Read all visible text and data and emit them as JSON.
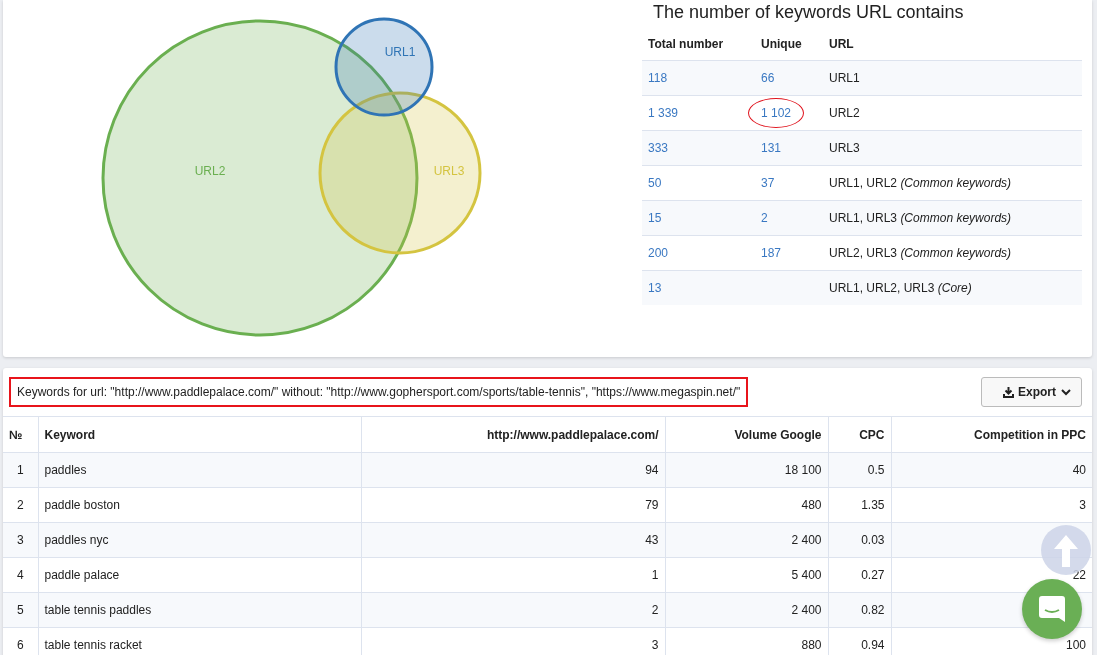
{
  "venn": {
    "circles": [
      {
        "label": "URL2",
        "color": "#6aaf50"
      },
      {
        "label": "URL3",
        "color": "#d4c440"
      },
      {
        "label": "URL1",
        "color": "#2f74b5"
      }
    ]
  },
  "summary": {
    "title": "The number of keywords URL contains",
    "columns": [
      "Total number",
      "Unique",
      "URL"
    ],
    "rows": [
      {
        "total": "118",
        "unique": "66",
        "url": "URL1",
        "highlighted": false
      },
      {
        "total": "1 339",
        "unique": "1 102",
        "url": "URL2",
        "highlighted": true
      },
      {
        "total": "333",
        "unique": "131",
        "url": "URL3",
        "highlighted": false
      },
      {
        "total": "50",
        "unique": "37",
        "url": "URL1, URL2 *(Common keywords)*",
        "highlighted": false
      },
      {
        "total": "15",
        "unique": "2",
        "url": "URL1, URL3 *(Common keywords)*",
        "highlighted": false
      },
      {
        "total": "200",
        "unique": "187",
        "url": "URL2, URL3 *(Common keywords)*",
        "highlighted": false
      },
      {
        "total": "13",
        "url": "URL1, URL2, URL3 *(Core)*",
        "highlighted": false
      }
    ]
  },
  "keywords": {
    "caption": "Keywords for url: \"http://www.paddlepalace.com/\" without: \"http://www.gophersport.com/sports/table-tennis\", \"https://www.megaspin.net/\"",
    "caption_highlighted": true,
    "export_button": "Export",
    "columns": [
      "№",
      "Keyword",
      "http://www.paddlepalace.com/",
      "Volume Google",
      "CPC",
      "Competition in PPC"
    ],
    "rows": [
      [
        "1",
        "paddles",
        "94",
        "18 100",
        "0.5",
        "40"
      ],
      [
        "2",
        "paddle boston",
        "79",
        "480",
        "1.35",
        "3"
      ],
      [
        "3",
        "paddles nyc",
        "43",
        "2 400",
        "0.03",
        null
      ],
      [
        "4",
        "paddle palace",
        "1",
        "5 400",
        "0.27",
        "22"
      ],
      [
        "5",
        "table tennis paddles",
        "2",
        "2 400",
        "0.82",
        null
      ],
      [
        "6",
        "table tennis racket",
        "3",
        "880",
        "0.94",
        "100"
      ]
    ]
  }
}
